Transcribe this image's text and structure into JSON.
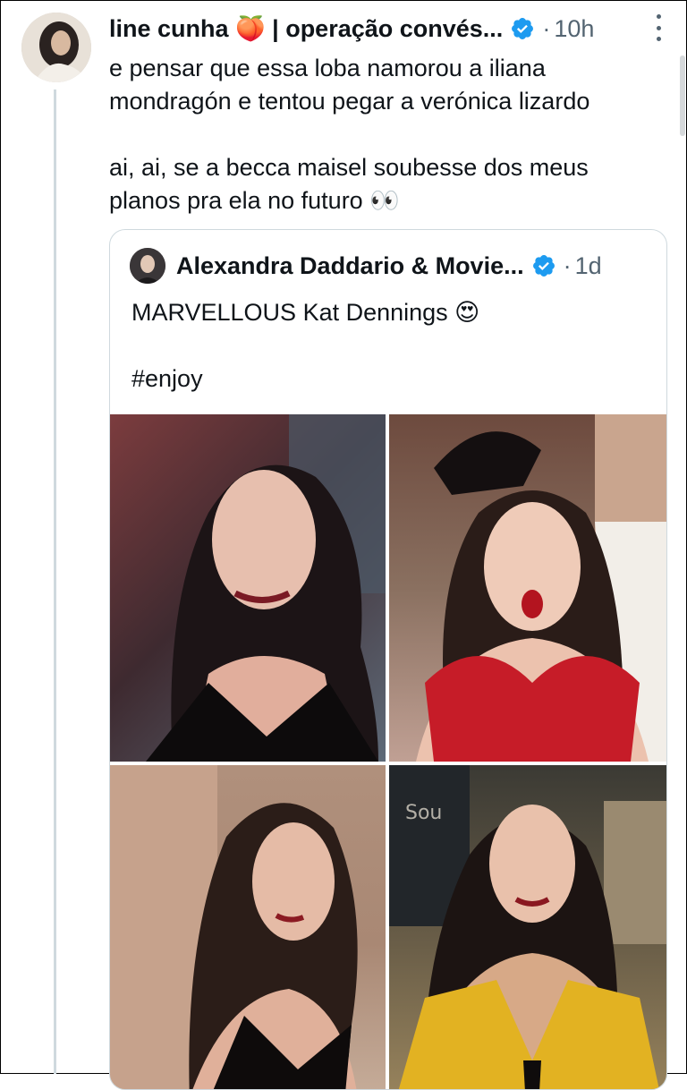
{
  "post": {
    "author_name": "line cunha 🍑 | operação convés...",
    "separator": "·",
    "time": "10h",
    "text": "e pensar que essa loba namorou a iliana\nmondragón e tentou pegar a verónica lizardo\n\nai, ai, se a becca maisel soubesse dos meus\nplanos pra ela no futuro 👀"
  },
  "quote": {
    "author_name": "Alexandra Daddario & Movie...",
    "separator": "·",
    "time": "1d",
    "text_line1": "MARVELLOUS Kat Dennings 😍",
    "text_line2": "#enjoy"
  },
  "colors": {
    "verified": "#1d9bf0",
    "secondary_text": "#536471",
    "thread_line": "#cfd9de"
  },
  "icons": [
    "verified-badge-icon",
    "more-options-icon"
  ]
}
